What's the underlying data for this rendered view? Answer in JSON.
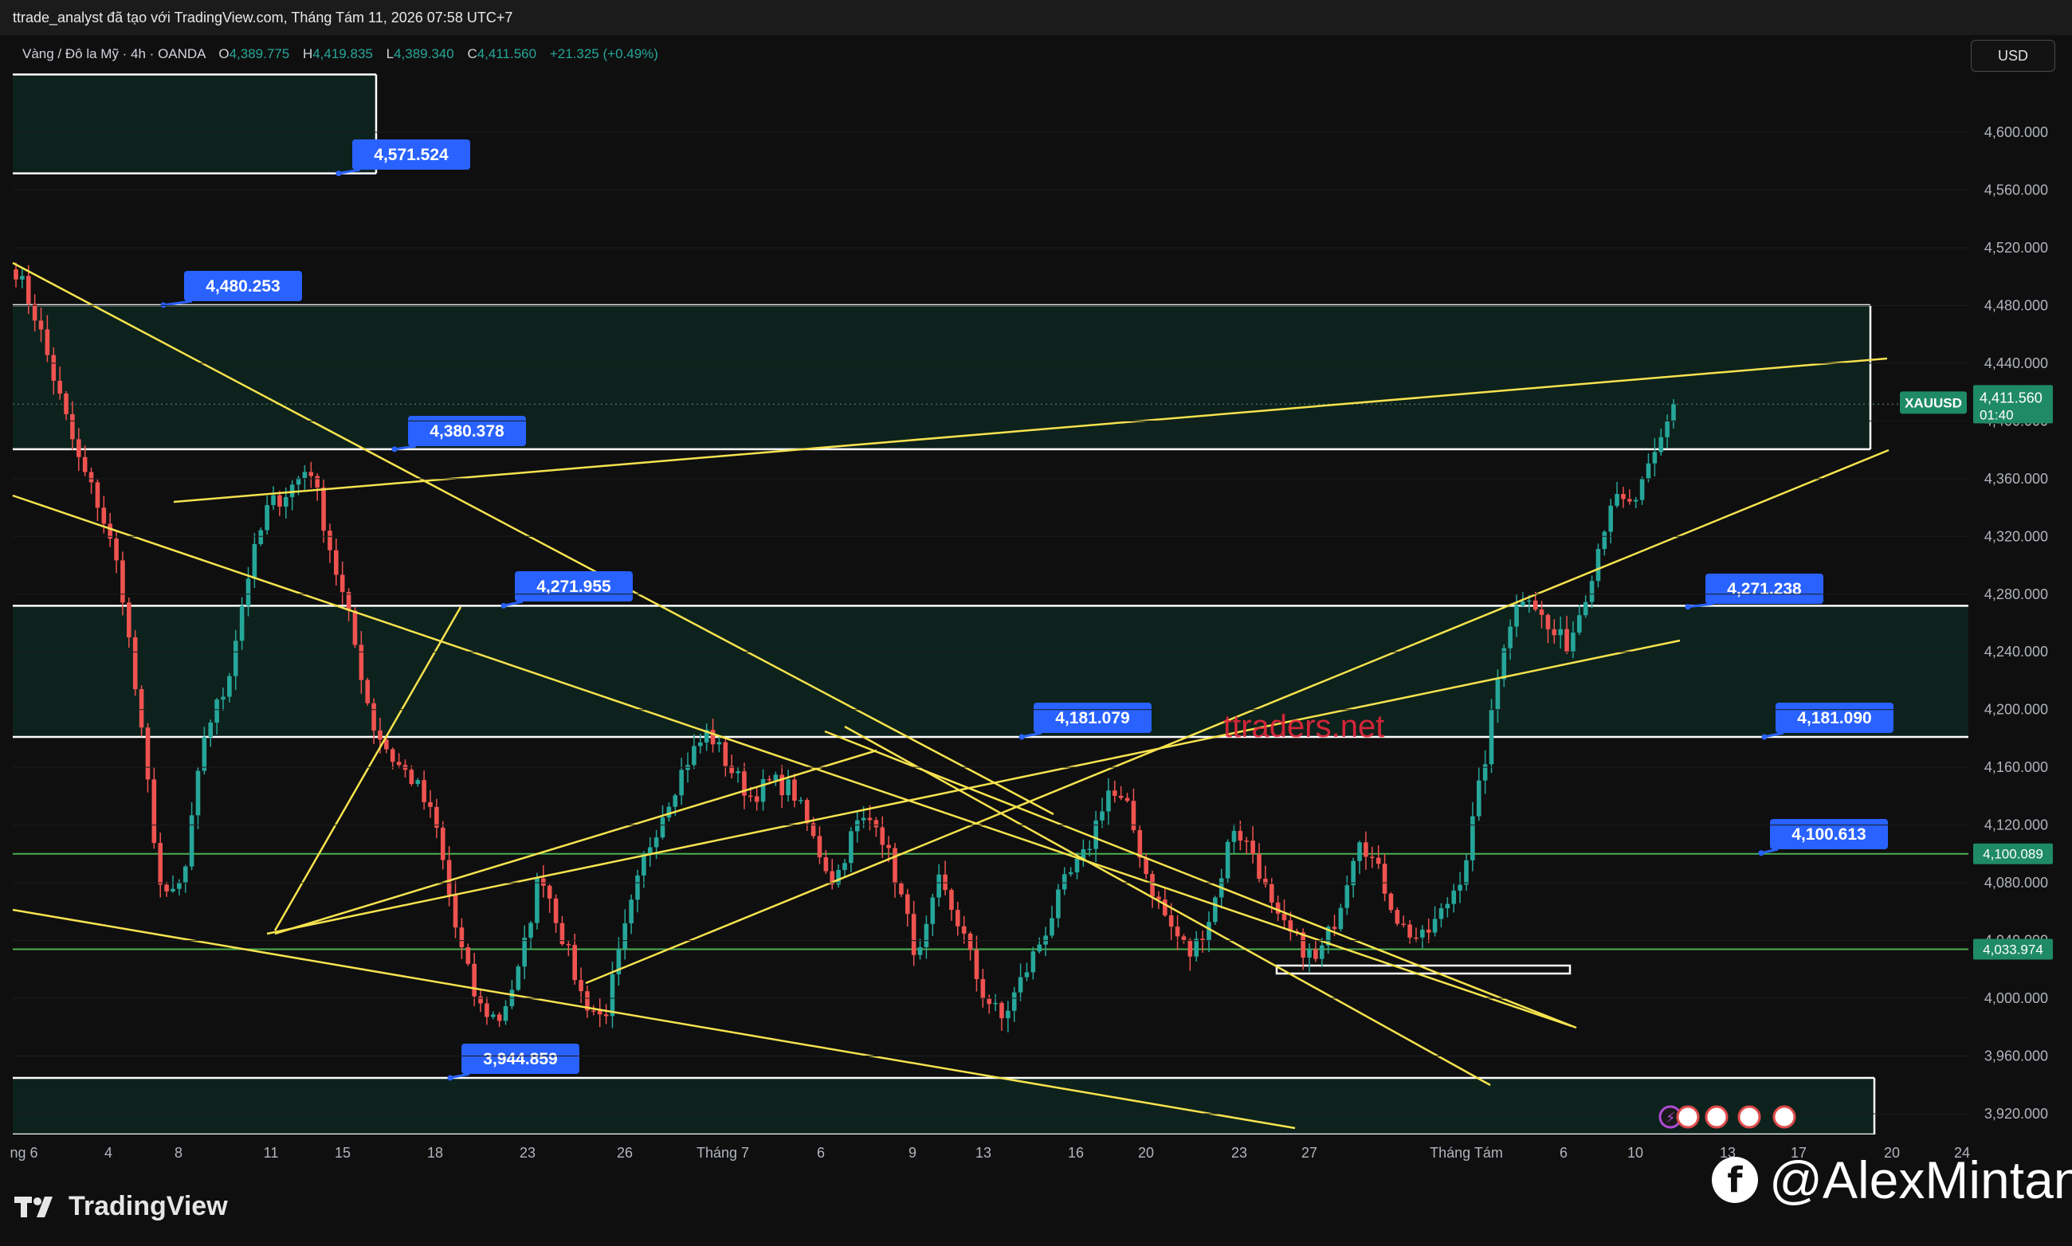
{
  "header": {
    "text": "ttrade_analyst đã tạo với TradingView.com, Tháng Tám 11, 2026 07:58 UTC+7"
  },
  "legend": {
    "symbol_desc": "Vàng / Đô la Mỹ · 4h · OANDA",
    "o_label": "O",
    "o": "4,389.775",
    "h_label": "H",
    "h": "4,419.835",
    "l_label": "L",
    "l": "4,389.340",
    "c_label": "C",
    "c": "4,411.560",
    "change": "+21.325 (+0.49%)"
  },
  "currency_button": "USD",
  "watermark_center": "ttraders.net",
  "footer": {
    "tradingview": "TradingView",
    "social": "@AlexMintan"
  },
  "colors": {
    "background": "#0f0f0f",
    "up": "#26a69a",
    "down": "#ef5350",
    "trendline": "#f7e34f",
    "zone_fill": "#0d2a22",
    "label_bg": "#2962ff",
    "green_line": "#4caf50",
    "price_tag": "#1f8a66"
  },
  "chart_data": {
    "type": "candlestick",
    "symbol": "XAUUSD",
    "interval": "4h",
    "ylim": [
      3900,
      4660
    ],
    "y_ticks": [
      "4,600.000",
      "4,560.000",
      "4,520.000",
      "4,480.000",
      "4,440.000",
      "4,400.000",
      "4,360.000",
      "4,320.000",
      "4,280.000",
      "4,240.000",
      "4,200.000",
      "4,160.000",
      "4,120.000",
      "4,080.000",
      "4,040.000",
      "4,000.000",
      "3,960.000",
      "3,920.000"
    ],
    "x_ticks": [
      "ng 6",
      "4",
      "8",
      "11",
      "15",
      "18",
      "23",
      "26",
      "Tháng 7",
      "6",
      "9",
      "13",
      "16",
      "20",
      "23",
      "27",
      "Tháng Tám",
      "6",
      "10",
      "13",
      "17",
      "20",
      "24"
    ],
    "last_price": {
      "label": "XAUUSD",
      "value": "4,411.560",
      "countdown": "01:40",
      "price": 4411.56
    },
    "horizontal_lines": [
      {
        "label": "4,100.089",
        "price": 4100.089
      },
      {
        "label": "4,033.974",
        "price": 4033.974
      }
    ],
    "zones": [
      {
        "top": 4640,
        "bottom": 4571.524
      },
      {
        "top": 4480.253,
        "bottom": 4380.378
      },
      {
        "top": 4271.955,
        "bottom": 4181.079
      },
      {
        "top": 3944.859,
        "bottom": 3900
      }
    ],
    "price_labels": [
      {
        "text": "4,571.524",
        "price": 4571.524
      },
      {
        "text": "4,480.253",
        "price": 4480.253
      },
      {
        "text": "4,380.378",
        "price": 4380.378
      },
      {
        "text": "4,271.955",
        "price": 4271.955
      },
      {
        "text": "4,271.238",
        "price": 4271.238
      },
      {
        "text": "4,181.079",
        "price": 4181.079
      },
      {
        "text": "4,181.090",
        "price": 4181.09
      },
      {
        "text": "4,100.613",
        "price": 4100.613
      },
      {
        "text": "3,944.859",
        "price": 3944.859
      }
    ],
    "path_keypoints": [
      4505,
      4470,
      4420,
      4372,
      4340,
      4290,
      4180,
      4065,
      4082,
      4185,
      4215,
      4290,
      4340,
      4352,
      4370,
      4310,
      4255,
      4190,
      4165,
      4150,
      4120,
      4045,
      3995,
      3985,
      4020,
      4090,
      4045,
      4000,
      3985,
      4045,
      4100,
      4135,
      4165,
      4185,
      4160,
      4140,
      4150,
      4145,
      4110,
      4080,
      4120,
      4125,
      4080,
      4025,
      4080,
      4050,
      4005,
      3985,
      4015,
      4045,
      4080,
      4100,
      4145,
      4130,
      4080,
      4050,
      4030,
      4060,
      4120,
      4100,
      4055,
      4040,
      4025,
      4060,
      4115,
      4085,
      4050,
      4040,
      4060,
      4090,
      4165,
      4255,
      4285,
      4255,
      4245,
      4290,
      4345,
      4340,
      4370,
      4411
    ]
  }
}
